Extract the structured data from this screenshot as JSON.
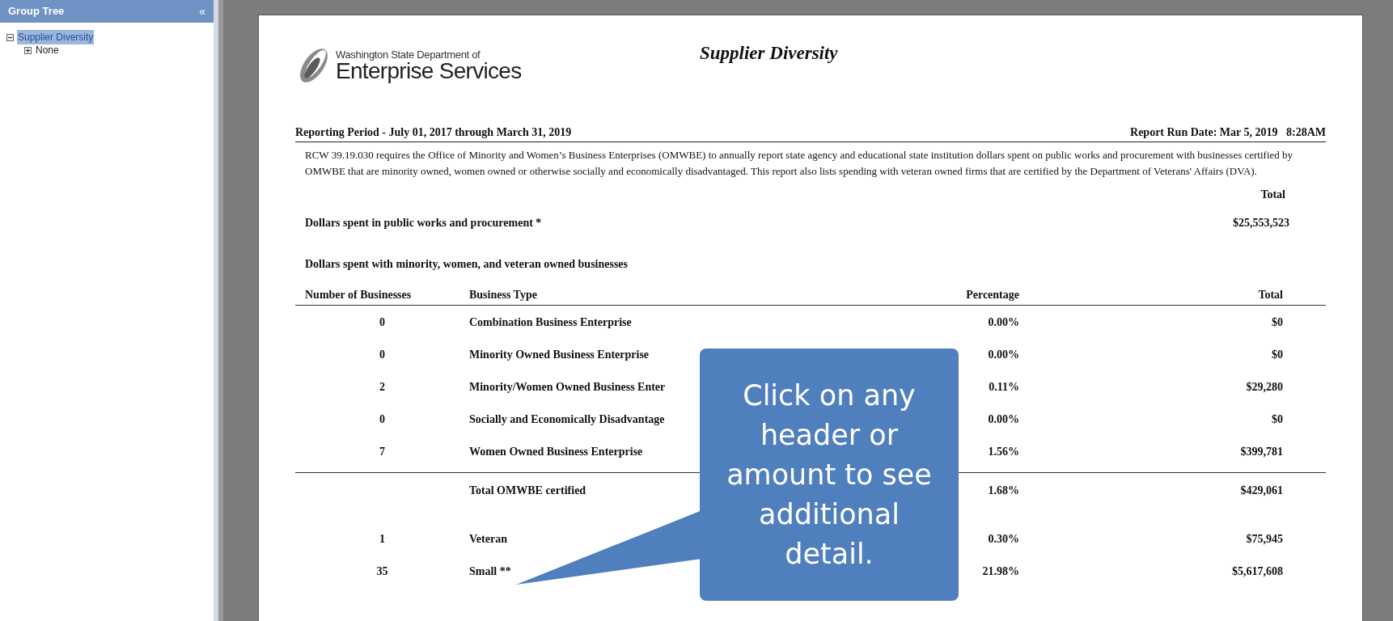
{
  "group_tree": {
    "title": "Group Tree",
    "collapse_glyph": "«",
    "items": [
      {
        "label": "Supplier Diversity",
        "selected": true,
        "expanded": true,
        "children": [
          {
            "label": "None",
            "selected": false,
            "expanded": false
          }
        ]
      }
    ]
  },
  "report": {
    "logo": {
      "line_1": "Washington State Department of",
      "line_2": "Enterprise Services"
    },
    "title": "Supplier Diversity",
    "reporting_period": "Reporting Period - July 01, 2017 through March 31, 2019",
    "run_date": "Report Run Date: Mar 5, 2019   8:28AM",
    "description": "RCW 39.19.030 requires the Office of Minority and Women’s Business Enterprises (OMWBE) to annually report state agency and educational state institution dollars spent on public works and procurement with businesses certified by OMWBE that are minority owned, women owned or otherwise socially and economically disadvantaged.  This report also lists spending with veteran owned firms that are certified by the Department of Veterans' Affairs (DVA).",
    "total_heading": "Total",
    "spent_label": "Dollars spent in public works and procurement *",
    "spent_total": "$25,553,523",
    "section_heading": "Dollars spent with minority, women, and veteran owned businesses",
    "columns": [
      "Number of Businesses",
      "Business Type",
      "Percentage",
      "Total"
    ],
    "rows": [
      {
        "kind": "item",
        "count": "0",
        "type": "Combination Business Enterprise",
        "percentage": "0.00%",
        "total": "$0"
      },
      {
        "kind": "item",
        "count": "0",
        "type": "Minority Owned Business Enterprise",
        "percentage": "0.00%",
        "total": "$0"
      },
      {
        "kind": "item",
        "count": "2",
        "type": "Minority/Women Owned Business Enter",
        "percentage": "0.11%",
        "total": "$29,280"
      },
      {
        "kind": "item",
        "count": "0",
        "type": "Socially and Economically Disadvantage",
        "percentage": "0.00%",
        "total": "$0"
      },
      {
        "kind": "item",
        "count": "7",
        "type": "Women Owned Business Enterprise",
        "percentage": "1.56%",
        "total": "$399,781"
      },
      {
        "kind": "subtotal",
        "type": "Total OMWBE certified",
        "percentage": "1.68%",
        "total": "$429,061"
      },
      {
        "kind": "item",
        "count": "1",
        "type": "Veteran",
        "percentage": "0.30%",
        "total": "$75,945"
      },
      {
        "kind": "item",
        "count": "35",
        "type": "Small **",
        "percentage": "21.98%",
        "total": "$5,617,608"
      }
    ]
  },
  "callout": {
    "text": "Click on any header or amount to see additional detail."
  }
}
